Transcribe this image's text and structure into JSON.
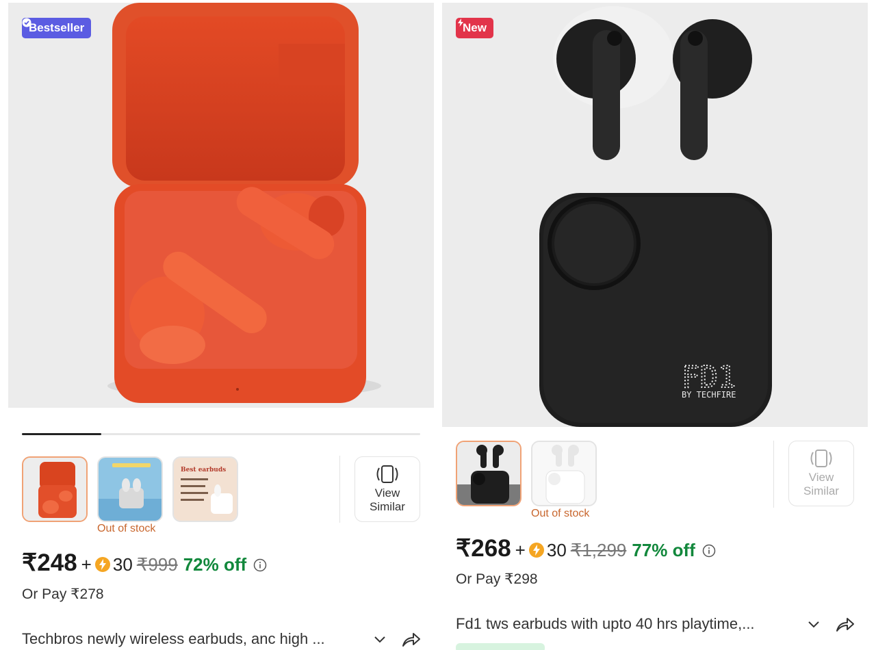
{
  "colors": {
    "bestseller_badge": "#5b5ce2",
    "new_badge": "#e2344a",
    "discount_green": "#12883c",
    "out_of_stock": "#c8662d",
    "selected_thumb_border": "#f0a275"
  },
  "products": [
    {
      "badge": "Bestseller",
      "badge_icon": "verified-check-icon",
      "gallery_progress": 0.2,
      "thumbnails": [
        {
          "name": "orange-earbuds-case",
          "selected": true
        },
        {
          "name": "blue-earbuds-poster",
          "selected": false
        },
        {
          "name": "best-earbuds-poster",
          "selected": false,
          "thumb_text": "Best earbuds"
        }
      ],
      "out_of_stock_label": "Out of stock",
      "view_similar": "View\nSimilar",
      "view_similar_line1": "View",
      "view_similar_line2": "Similar",
      "price": "₹248",
      "plus": "+",
      "coins": "30",
      "mrp": "₹999",
      "discount": "72% off",
      "or_pay": "Or Pay ₹278",
      "title": "Techbros newly wireless earbuds, anc high ..."
    },
    {
      "badge": "New",
      "badge_icon": "lightning-icon",
      "thumbnails": [
        {
          "name": "black-fd1-earbuds",
          "selected": true
        },
        {
          "name": "white-fd1-earbuds",
          "selected": false
        }
      ],
      "out_of_stock_label": "Out of stock",
      "view_similar_line1": "View",
      "view_similar_line2": "Similar",
      "price": "₹268",
      "plus": "+",
      "coins": "30",
      "mrp": "₹1,299",
      "discount": "77% off",
      "or_pay": "Or Pay ₹298",
      "title": "Fd1 tws earbuds with upto 40 hrs playtime,...",
      "case_brand": "FD1",
      "case_sub": "BY TECHFIRE"
    }
  ]
}
